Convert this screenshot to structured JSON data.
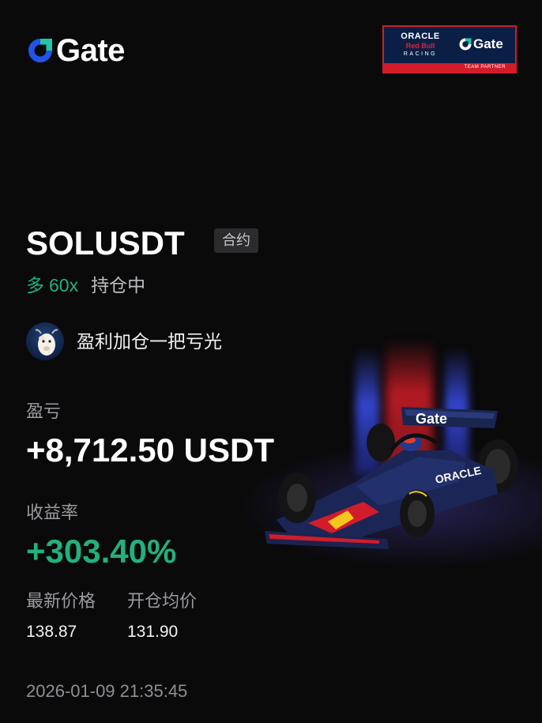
{
  "brand": {
    "name": "Gate",
    "accent": "#2354e6"
  },
  "partner": {
    "line1": "ORACLE",
    "line2": "Red Bull",
    "line3": "RACING",
    "gate": "Gate",
    "strip": "TEAM PARTNER"
  },
  "position": {
    "pair": "SOLUSDT",
    "tag": "合约",
    "side": "多",
    "leverage": "60x",
    "status": "持仓中"
  },
  "user": {
    "name": "盈利加仓一把亏光"
  },
  "pnl": {
    "label": "盈亏",
    "value": "+8,712.50 USDT"
  },
  "roi": {
    "label": "收益率",
    "value": "+303.40%"
  },
  "prices": {
    "last_label": "最新价格",
    "last_value": "138.87",
    "entry_label": "开仓均价",
    "entry_value": "131.90"
  },
  "timestamp": "2026-01-09 21:35:45",
  "car": {
    "livery": "Gate",
    "livery2": "ORACLE"
  },
  "colors": {
    "profit": "#22b17a",
    "background": "#0a0a0b",
    "redbull_red": "#d21c2a",
    "navy": "#0b1f46"
  }
}
